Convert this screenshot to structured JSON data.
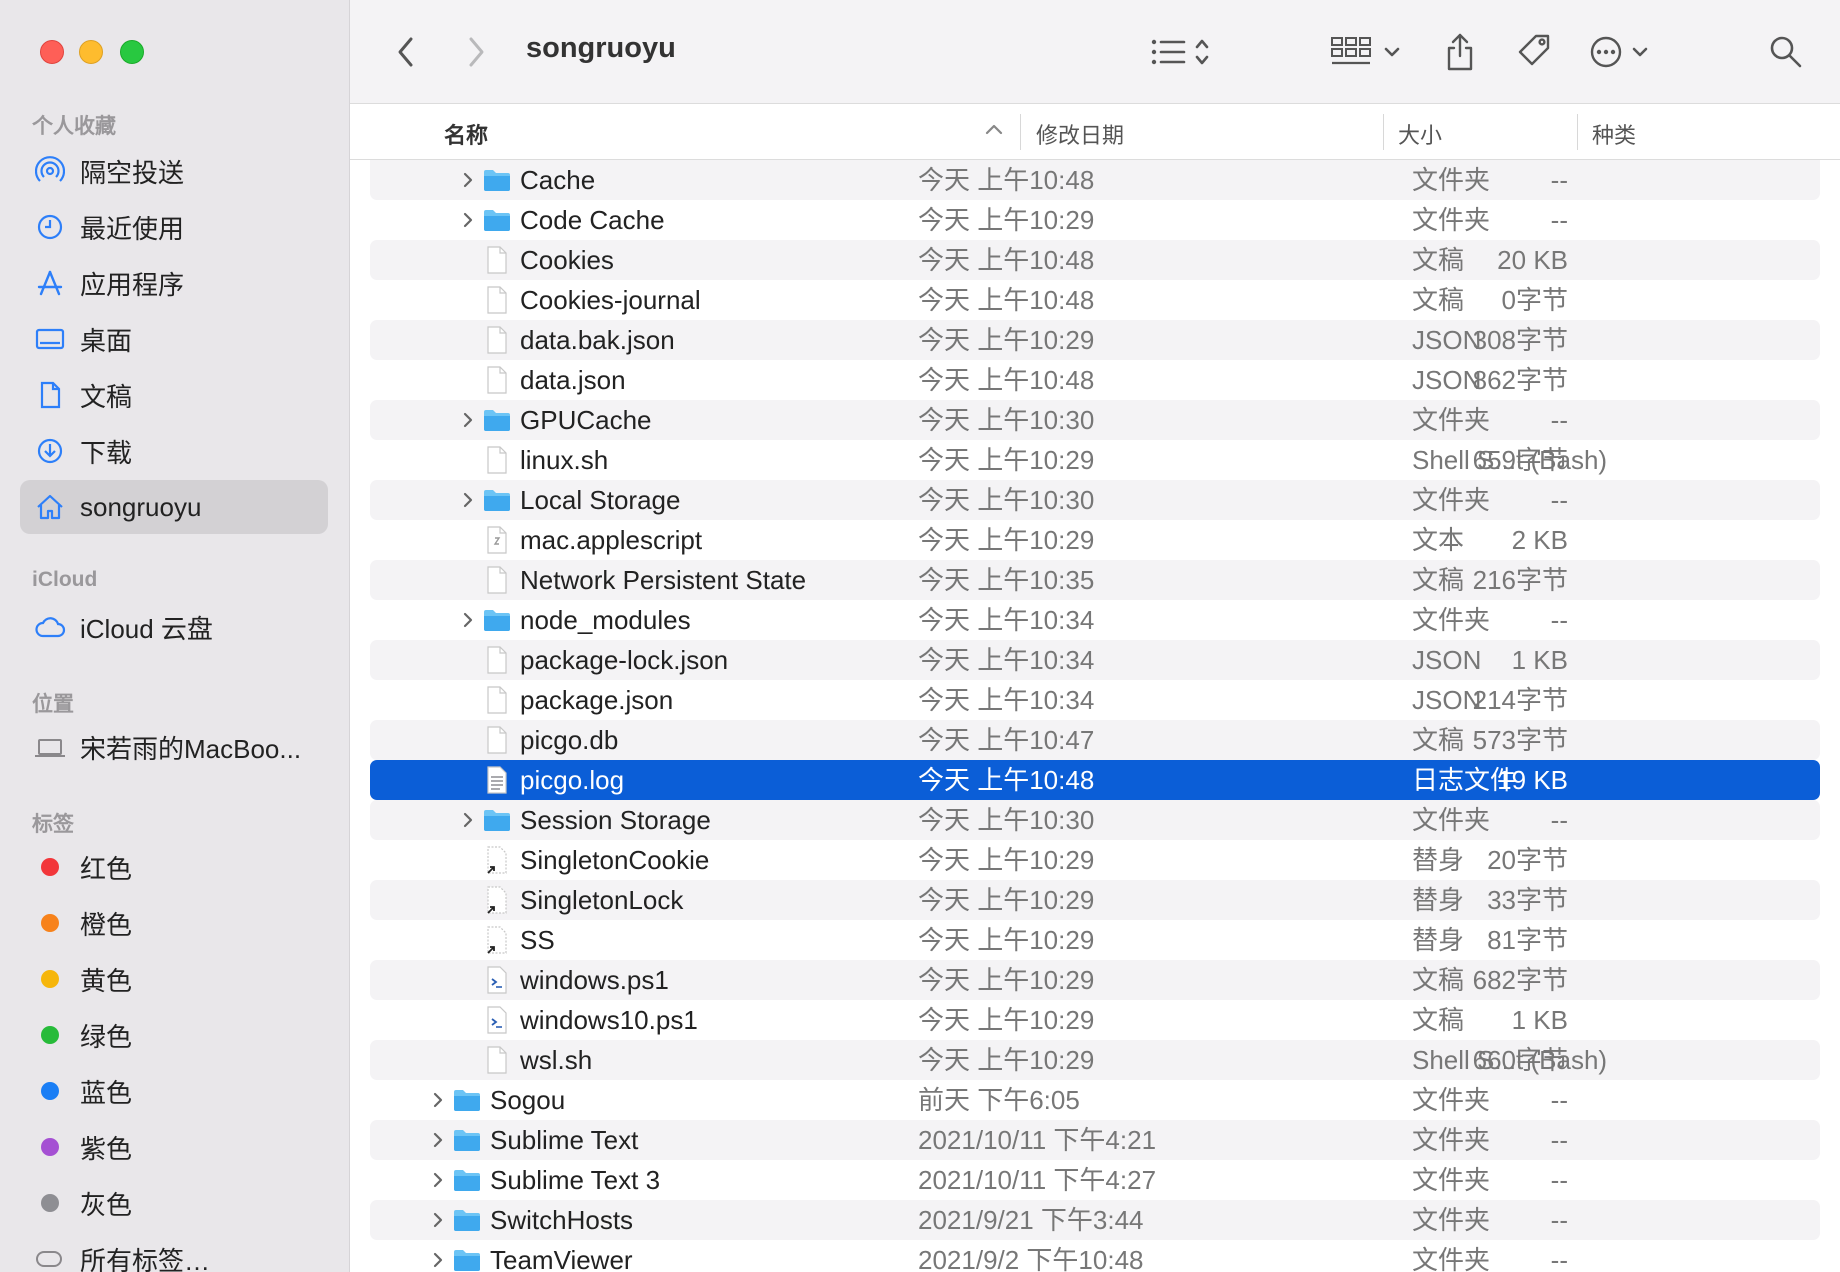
{
  "window": {
    "title": "songruoyu"
  },
  "sidebar": {
    "favorites_title": "个人收藏",
    "favorites": [
      {
        "label": "隔空投送",
        "icon": "airdrop-icon"
      },
      {
        "label": "最近使用",
        "icon": "clock-icon"
      },
      {
        "label": "应用程序",
        "icon": "applications-icon"
      },
      {
        "label": "桌面",
        "icon": "desktop-icon"
      },
      {
        "label": "文稿",
        "icon": "document-icon"
      },
      {
        "label": "下载",
        "icon": "download-icon"
      },
      {
        "label": "songruoyu",
        "icon": "home-icon",
        "active": true
      }
    ],
    "icloud_title": "iCloud",
    "icloud": [
      {
        "label": "iCloud 云盘",
        "icon": "cloud-icon"
      }
    ],
    "locations_title": "位置",
    "locations": [
      {
        "label": "宋若雨的MacBoo...",
        "icon": "laptop-icon"
      }
    ],
    "tags_title": "标签",
    "tags": [
      {
        "label": "红色",
        "color": "#f2363a"
      },
      {
        "label": "橙色",
        "color": "#f7821b"
      },
      {
        "label": "黄色",
        "color": "#f6b60b"
      },
      {
        "label": "绿色",
        "color": "#27bb3a"
      },
      {
        "label": "蓝色",
        "color": "#1a7ef5"
      },
      {
        "label": "紫色",
        "color": "#a550d3"
      },
      {
        "label": "灰色",
        "color": "#8e8e93"
      },
      {
        "label": "所有标签…",
        "color": ""
      }
    ]
  },
  "columns": {
    "name": "名称",
    "date": "修改日期",
    "size": "大小",
    "kind": "种类"
  },
  "files": [
    {
      "name": "Cache",
      "type": "folder",
      "date": "今天 上午10:48",
      "size": "--",
      "kind": "文件夹"
    },
    {
      "name": "Code Cache",
      "type": "folder",
      "date": "今天 上午10:29",
      "size": "--",
      "kind": "文件夹"
    },
    {
      "name": "Cookies",
      "type": "doc",
      "date": "今天 上午10:48",
      "size": "20 KB",
      "kind": "文稿"
    },
    {
      "name": "Cookies-journal",
      "type": "doc",
      "date": "今天 上午10:48",
      "size": "0字节",
      "kind": "文稿"
    },
    {
      "name": "data.bak.json",
      "type": "doc",
      "date": "今天 上午10:29",
      "size": "308字节",
      "kind": "JSON"
    },
    {
      "name": "data.json",
      "type": "doc",
      "date": "今天 上午10:48",
      "size": "862字节",
      "kind": "JSON"
    },
    {
      "name": "GPUCache",
      "type": "folder",
      "date": "今天 上午10:30",
      "size": "--",
      "kind": "文件夹"
    },
    {
      "name": "linux.sh",
      "type": "doc",
      "date": "今天 上午10:29",
      "size": "659字节",
      "kind": "Shell S...t (Bash)"
    },
    {
      "name": "Local Storage",
      "type": "folder",
      "date": "今天 上午10:30",
      "size": "--",
      "kind": "文件夹"
    },
    {
      "name": "mac.applescript",
      "type": "script",
      "date": "今天 上午10:29",
      "size": "2 KB",
      "kind": "文本"
    },
    {
      "name": "Network Persistent State",
      "type": "doc",
      "date": "今天 上午10:35",
      "size": "216字节",
      "kind": "文稿"
    },
    {
      "name": "node_modules",
      "type": "folder",
      "date": "今天 上午10:34",
      "size": "--",
      "kind": "文件夹"
    },
    {
      "name": "package-lock.json",
      "type": "doc",
      "date": "今天 上午10:34",
      "size": "1 KB",
      "kind": "JSON"
    },
    {
      "name": "package.json",
      "type": "doc",
      "date": "今天 上午10:34",
      "size": "214字节",
      "kind": "JSON"
    },
    {
      "name": "picgo.db",
      "type": "doc",
      "date": "今天 上午10:47",
      "size": "573字节",
      "kind": "文稿"
    },
    {
      "name": "picgo.log",
      "type": "log",
      "date": "今天 上午10:48",
      "size": "19 KB",
      "kind": "日志文件",
      "selected": true
    },
    {
      "name": "Session Storage",
      "type": "folder",
      "date": "今天 上午10:30",
      "size": "--",
      "kind": "文件夹"
    },
    {
      "name": "SingletonCookie",
      "type": "alias",
      "date": "今天 上午10:29",
      "size": "20字节",
      "kind": "替身"
    },
    {
      "name": "SingletonLock",
      "type": "alias",
      "date": "今天 上午10:29",
      "size": "33字节",
      "kind": "替身"
    },
    {
      "name": "SS",
      "type": "alias",
      "date": "今天 上午10:29",
      "size": "81字节",
      "kind": "替身"
    },
    {
      "name": "windows.ps1",
      "type": "ps",
      "date": "今天 上午10:29",
      "size": "682字节",
      "kind": "文稿"
    },
    {
      "name": "windows10.ps1",
      "type": "ps",
      "date": "今天 上午10:29",
      "size": "1 KB",
      "kind": "文稿"
    },
    {
      "name": "wsl.sh",
      "type": "doc",
      "date": "今天 上午10:29",
      "size": "660字节",
      "kind": "Shell S...t (Bash)"
    },
    {
      "name": "Sogou",
      "type": "folder",
      "level": 0,
      "date": "前天 下午6:05",
      "size": "--",
      "kind": "文件夹"
    },
    {
      "name": "Sublime Text",
      "type": "folder",
      "level": 0,
      "date": "2021/10/11 下午4:21",
      "size": "--",
      "kind": "文件夹"
    },
    {
      "name": "Sublime Text 3",
      "type": "folder",
      "level": 0,
      "date": "2021/10/11 下午4:27",
      "size": "--",
      "kind": "文件夹"
    },
    {
      "name": "SwitchHosts",
      "type": "folder",
      "level": 0,
      "date": "2021/9/21 下午3:44",
      "size": "--",
      "kind": "文件夹"
    },
    {
      "name": "TeamViewer",
      "type": "folder",
      "level": 0,
      "date": "2021/9/2 下午10:48",
      "size": "--",
      "kind": "文件夹"
    }
  ]
}
